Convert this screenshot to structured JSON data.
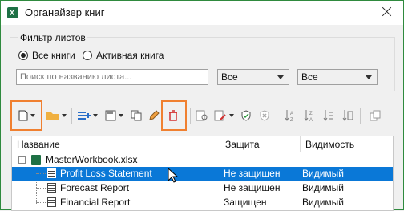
{
  "window": {
    "title": "Органайзер книг"
  },
  "filter": {
    "group_label": "Фильтр листов",
    "radio_all": "Все книги",
    "radio_active": "Активная книга",
    "search_placeholder": "Поиск по названию листа...",
    "protection_select": "Все",
    "visibility_select": "Все"
  },
  "toolbar": {
    "icons": [
      "new-sheet-icon",
      "open-folder-icon",
      "insert-sheet-icon",
      "save-sheet-icon",
      "copy-icon",
      "rename-icon",
      "delete-icon",
      "preview-icon",
      "edit-icon",
      "protect-icon",
      "unprotect-icon",
      "sort-az-icon",
      "sort-za-icon",
      "sort-custom-icon",
      "hide-icon"
    ],
    "highlight_color": "#f08030"
  },
  "tree": {
    "columns": [
      "Название",
      "Защита",
      "Видимость"
    ],
    "workbook": "MasterWorkbook.xlsx",
    "rows": [
      {
        "name": "Profit Loss Statement",
        "protection": "Не защищен",
        "visibility": "Видимый",
        "selected": true
      },
      {
        "name": "Forecast Report",
        "protection": "Не защищен",
        "visibility": "Видимый",
        "selected": false
      },
      {
        "name": "Financial Report",
        "protection": "Защищен",
        "visibility": "Видимый",
        "selected": false
      }
    ],
    "selection_color": "#0a78d7"
  }
}
